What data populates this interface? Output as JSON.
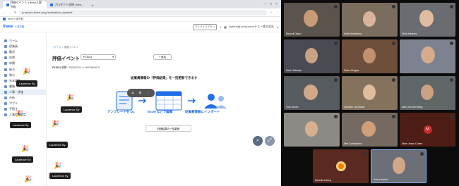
{
  "browser": {
    "tabs": [
      {
        "label": "評価イベント | freee人事労務"
      },
      {
        "label": "プロダクト説明 | free..."
      }
    ],
    "url": "p.secure.freee.co.jp/evaluation_cycles/#",
    "bookmark": "freee人事労務"
  },
  "app": {
    "brand": "freee",
    "product": "人事労務",
    "header_chip": "アドバイスプラン",
    "company": "[internal] productionテスト株式会社"
  },
  "sidebar": {
    "items": [
      {
        "label": "ホーム"
      },
      {
        "label": "従業員"
      },
      {
        "label": "勤怠"
      },
      {
        "label": "休暇"
      },
      {
        "label": "申請"
      },
      {
        "label": "給与"
      },
      {
        "label": "賞与"
      },
      {
        "label": "年末調整"
      },
      {
        "label": "書類"
      },
      {
        "label": "人事・評価"
      },
      {
        "label": "分析"
      },
      {
        "label": "アプリ"
      },
      {
        "label": "手続き"
      },
      {
        "label": "人事労務設定"
      }
    ]
  },
  "main": {
    "breadcrumb_home": "ホーム",
    "breadcrumb_current": "評価イベント",
    "title": "評価イベント",
    "period_select": "FY2021",
    "add_button": "+ 追加",
    "period_label": "FY2021",
    "period_range": "期間 : 2020/07/01 〜 2021/06/30",
    "headline": "従業員情報の「評価結果」を一括更新できます",
    "step1": "テンプレートを DL",
    "step2": "Excel などで編集",
    "step3": "従業員情報にインポート",
    "bulk_button": "評価結果の一括更新"
  },
  "overlay_labels": [
    {
      "text": "Laurence Sy"
    },
    {
      "text": "Laurence Sy"
    },
    {
      "text": "Laurence Sy"
    },
    {
      "text": "Laurence Sy"
    },
    {
      "text": "Laurence Sy"
    }
  ],
  "participants": [
    {
      "name": "Marcell Olson"
    },
    {
      "name": "Keith Nickelinna"
    },
    {
      "name": "Chris Hennes"
    },
    {
      "name": "Kevin Tatsuya"
    },
    {
      "name": "Pedro Burgos"
    },
    {
      "name": ""
    },
    {
      "name": "Yuki Shotin"
    },
    {
      "name": "Caroline Jay Bauer"
    },
    {
      "name": "Alex Van Den Berg"
    },
    {
      "name": ""
    },
    {
      "name": "Neil Constantino"
    },
    {
      "name": "Mare Jesse Cortez",
      "initial": "M"
    },
    {
      "name": "Marelle Antony"
    },
    {
      "name": "Anisa Hamid"
    }
  ],
  "colors": {
    "accent": "#1f6fe5",
    "avatar_red": "#c62828",
    "sidebar_selected": "#e7effb"
  }
}
